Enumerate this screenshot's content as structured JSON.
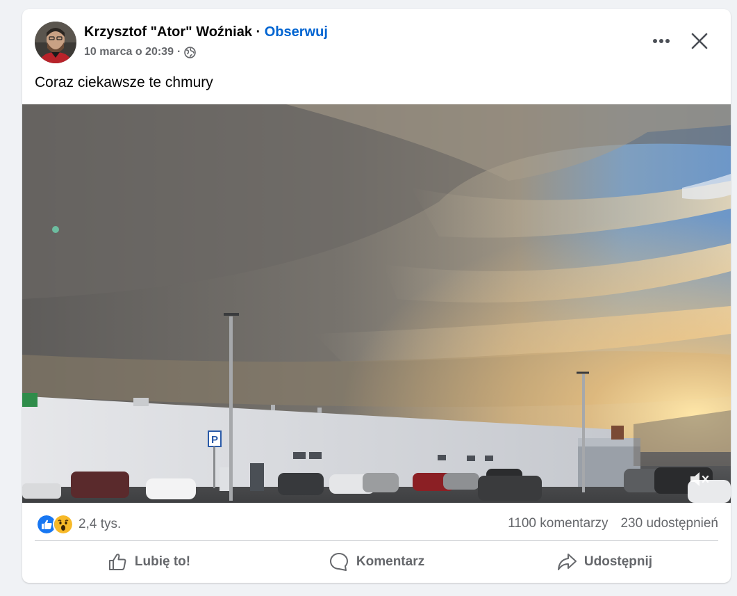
{
  "post": {
    "author": "Krzysztof \"Ator\" Woźniak",
    "separator": "·",
    "follow_label": "Obserwuj",
    "date": "10 marca o 20:39",
    "date_separator": "·",
    "audience_icon": "globe-icon",
    "text": "Coraz ciekawsze te chmury"
  },
  "header_actions": {
    "more_icon": "more-horizontal-icon",
    "close_icon": "close-icon"
  },
  "media": {
    "volume_icon": "speaker-muted-icon",
    "parking_sign": "P"
  },
  "stats": {
    "reaction_icons": [
      "like-icon",
      "wow-icon"
    ],
    "reaction_count": "2,4 tys.",
    "comments": "1100 komentarzy",
    "shares": "230 udostępnień"
  },
  "actions": {
    "like_label": "Lubię to!",
    "comment_label": "Komentarz",
    "share_label": "Udostępnij"
  },
  "colors": {
    "accent": "#0064d1",
    "secondary_text": "#65676b",
    "background": "#f0f2f5",
    "like_blue": "#1877f2",
    "wow_yellow": "#f7b928"
  }
}
